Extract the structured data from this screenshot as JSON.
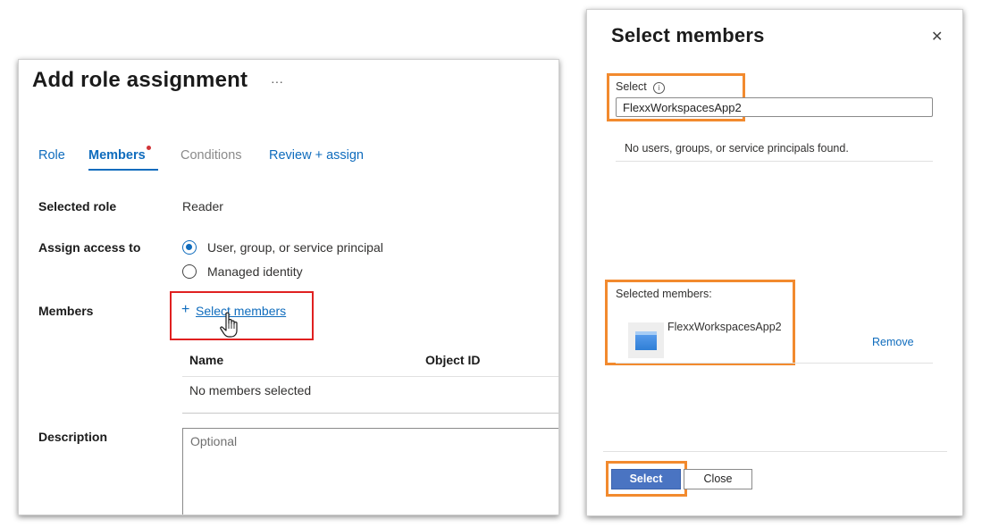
{
  "role_panel": {
    "title": "Add role assignment",
    "more": "···",
    "tabs": [
      {
        "label": "Role"
      },
      {
        "label": "Members"
      },
      {
        "label": "Conditions"
      },
      {
        "label": "Review + assign"
      }
    ],
    "selected_role_label": "Selected role",
    "selected_role_value": "Reader",
    "assign_access_label": "Assign access to",
    "assign_options": [
      {
        "label": "User, group, or service principal",
        "checked": true
      },
      {
        "label": "Managed identity",
        "checked": false
      }
    ],
    "members_label": "Members",
    "select_members_plus": "+",
    "select_members_link": "Select members",
    "table": {
      "columns": [
        "Name",
        "Object ID"
      ],
      "empty_text": "No members selected"
    },
    "description_label": "Description",
    "description_placeholder": "Optional"
  },
  "select_panel": {
    "title": "Select members",
    "close_glyph": "✕",
    "select_label": "Select",
    "info_glyph": "i",
    "search_value": "FlexxWorkspacesApp2",
    "no_results": "No users, groups, or service principals found.",
    "selected_members_label": "Selected members:",
    "selected_members": [
      {
        "name": "FlexxWorkspacesApp2",
        "remove_label": "Remove"
      }
    ],
    "select_button": "Select",
    "close_button": "Close"
  },
  "colors": {
    "accent": "#0f6cbd",
    "highlight_red": "#e02020",
    "highlight_orange": "#f28a2e",
    "primary_button": "#4a74c2",
    "notification_dot": "#d13438"
  }
}
